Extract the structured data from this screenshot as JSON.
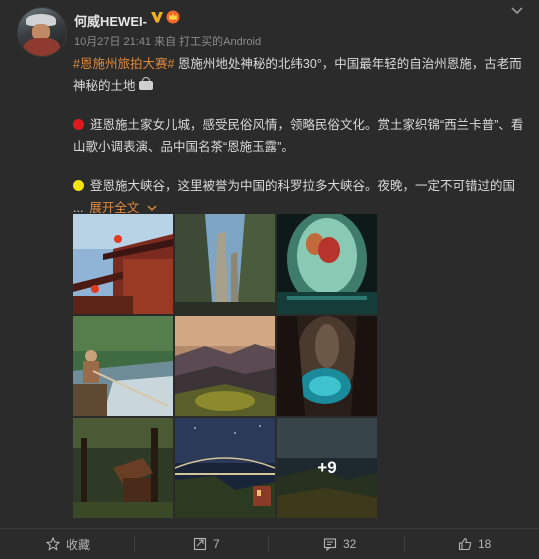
{
  "post": {
    "username": "何威HEWEI-",
    "meta": "10月27日 21:41 来自 打工买的Android",
    "hashtag": "#恩施州旅拍大赛#",
    "intro": " 恩施州地处神秘的北纬30°，中国最年轻的自治州恩施，古老而神秘的土地",
    "para1": "逛恩施土家女儿城，感受民俗风情，领略民俗文化。赏土家织锦“西兰卡普”、看山歌小调表演、品中国名茶“恩施玉露”。",
    "para2": "登恩施大峡谷，这里被誉为中国的科罗拉多大峡谷。夜晚，一定不可错过的国",
    "ellipsis": "...",
    "expand_label": "展开全文",
    "more_photos": "+9"
  },
  "footer": {
    "favorite_label": "收藏",
    "repost_count": "7",
    "comment_count": "32",
    "like_count": "18"
  },
  "colors": {
    "accent": "#e08a3c",
    "red_dot": "#e0191c",
    "yellow_dot": "#f5e411"
  }
}
